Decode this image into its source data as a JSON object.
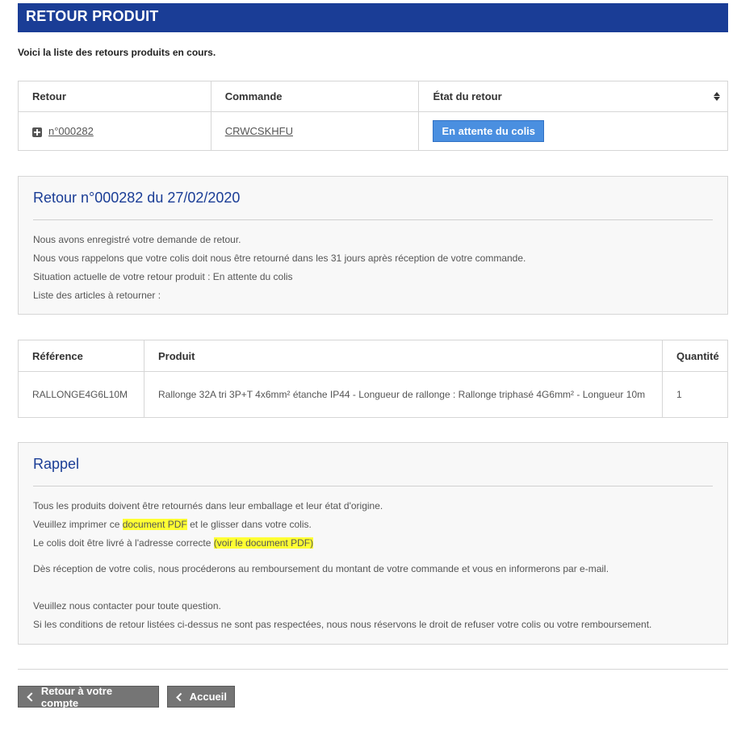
{
  "header": {
    "title": "RETOUR PRODUIT"
  },
  "intro": "Voici la liste des retours produits en cours.",
  "returns_table": {
    "headers": [
      "Retour",
      "Commande",
      "État du retour"
    ],
    "rows": [
      {
        "return_no": "n°000282",
        "order": "CRWCSKHFU",
        "status": "En attente du colis"
      }
    ]
  },
  "detail": {
    "title": "Retour n°000282 du 27/02/2020",
    "lines": [
      "Nous avons enregistré votre demande de retour.",
      "Nous vous rappelons que votre colis doit nous être retourné dans les 31 jours après réception de votre commande.",
      "Situation actuelle de votre retour produit : En attente du colis",
      "Liste des articles à retourner :"
    ]
  },
  "items_table": {
    "headers": [
      "Référence",
      "Produit",
      "Quantité"
    ],
    "rows": [
      {
        "reference": "RALLONGE4G6L10M",
        "product": "Rallonge 32A tri 3P+T 4x6mm² étanche IP44 - Longueur de rallonge : Rallonge triphasé 4G6mm² - Longueur 10m",
        "quantity": "1"
      }
    ]
  },
  "reminder": {
    "title": "Rappel",
    "line1": "Tous les produits doivent être retournés dans leur emballage et leur état d'origine.",
    "line2_pre": "Veuillez imprimer ce ",
    "line2_link": "document PDF",
    "line2_post": " et le glisser dans votre colis.",
    "line3_pre": "Le colis doit être livré à l'adresse correcte ",
    "line3_link": "(voir le document PDF)",
    "line4": "Dès réception de votre colis, nous procéderons au remboursement du montant de votre commande et vous en informerons par e-mail.",
    "line5": "Veuillez nous contacter pour toute question.",
    "line6": "Si les conditions de retour listées ci-dessus ne sont pas respectées, nous nous réservons le droit de refuser votre colis ou votre remboursement."
  },
  "footer": {
    "back_account_label": "Retour à votre compte",
    "home_label": "Accueil"
  },
  "colors": {
    "header_bg": "#1a3d96",
    "status_button": "#4a8fe0",
    "highlight": "#ffff33",
    "nav_button": "#757575"
  }
}
